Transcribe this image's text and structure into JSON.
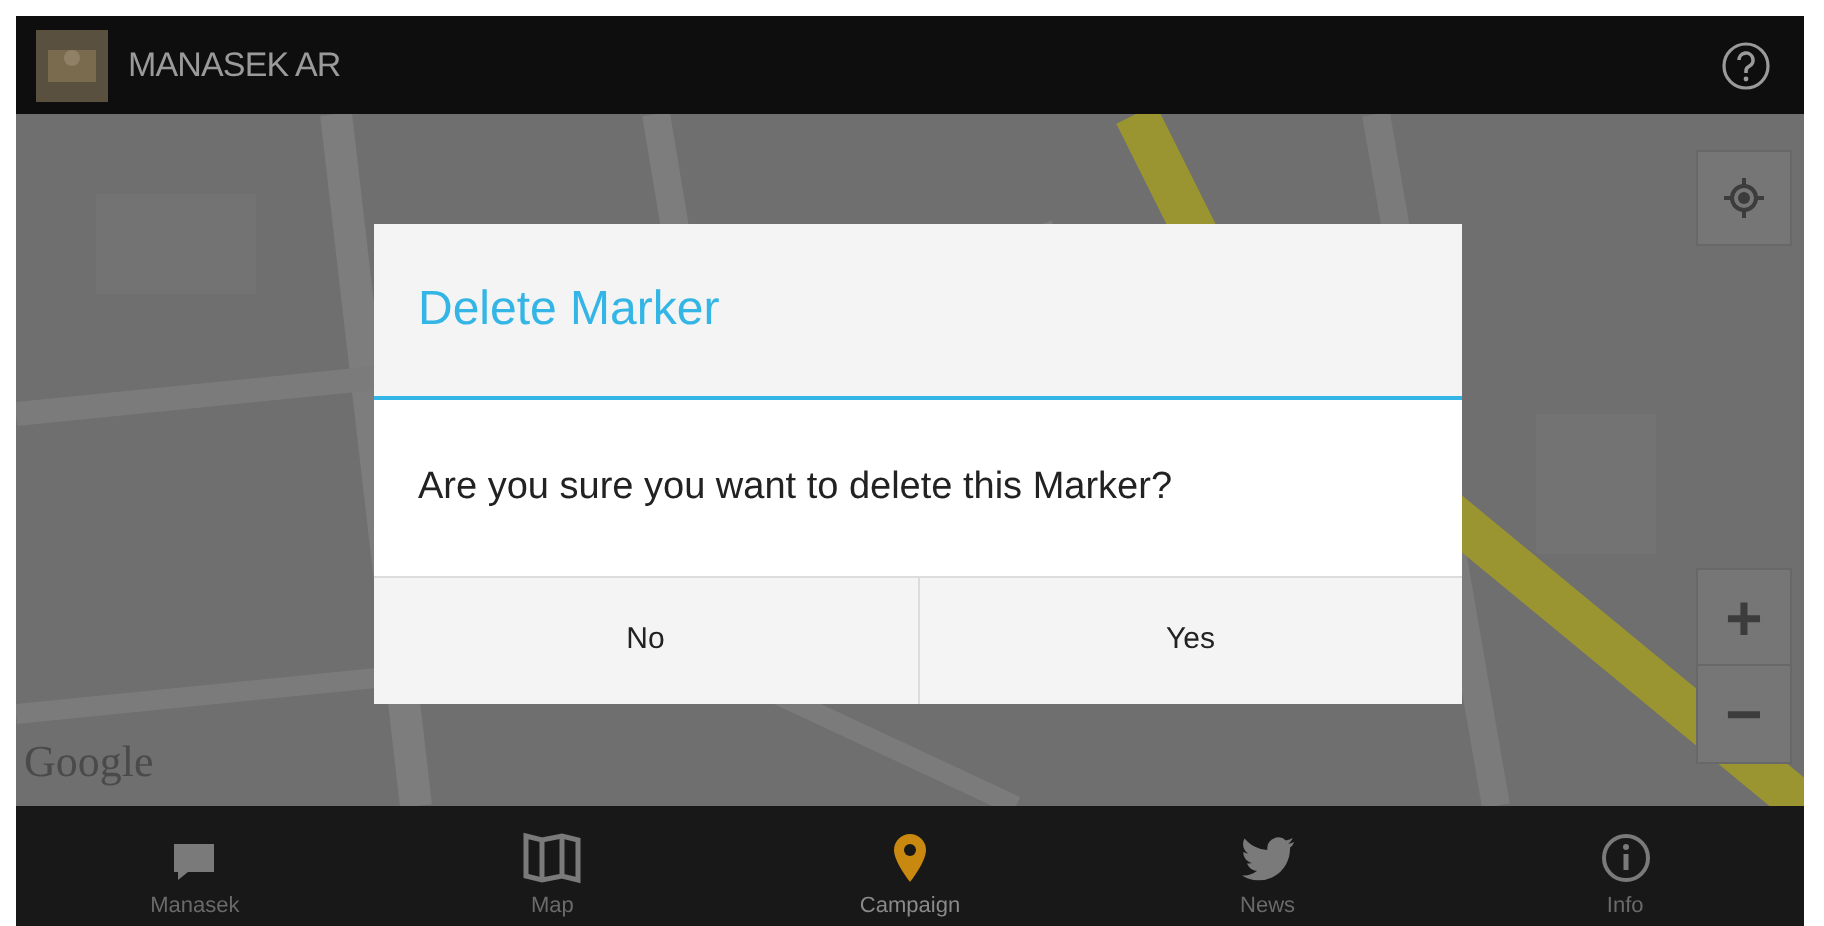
{
  "app_bar": {
    "title": "MANASEK AR"
  },
  "map": {
    "attribution": "Google",
    "zoom_in": "+",
    "zoom_out": "−"
  },
  "dialog": {
    "title": "Delete Marker",
    "message": "Are you sure you want to delete this Marker?",
    "buttons": [
      "No",
      "Yes"
    ]
  },
  "bottom_nav": [
    {
      "label": "Manasek",
      "kind": "chat",
      "selected": false
    },
    {
      "label": "Map",
      "kind": "map",
      "selected": false
    },
    {
      "label": "Campaign",
      "kind": "pin",
      "selected": true
    },
    {
      "label": "News",
      "kind": "bird",
      "selected": false
    },
    {
      "label": "Info",
      "kind": "info",
      "selected": false
    }
  ]
}
